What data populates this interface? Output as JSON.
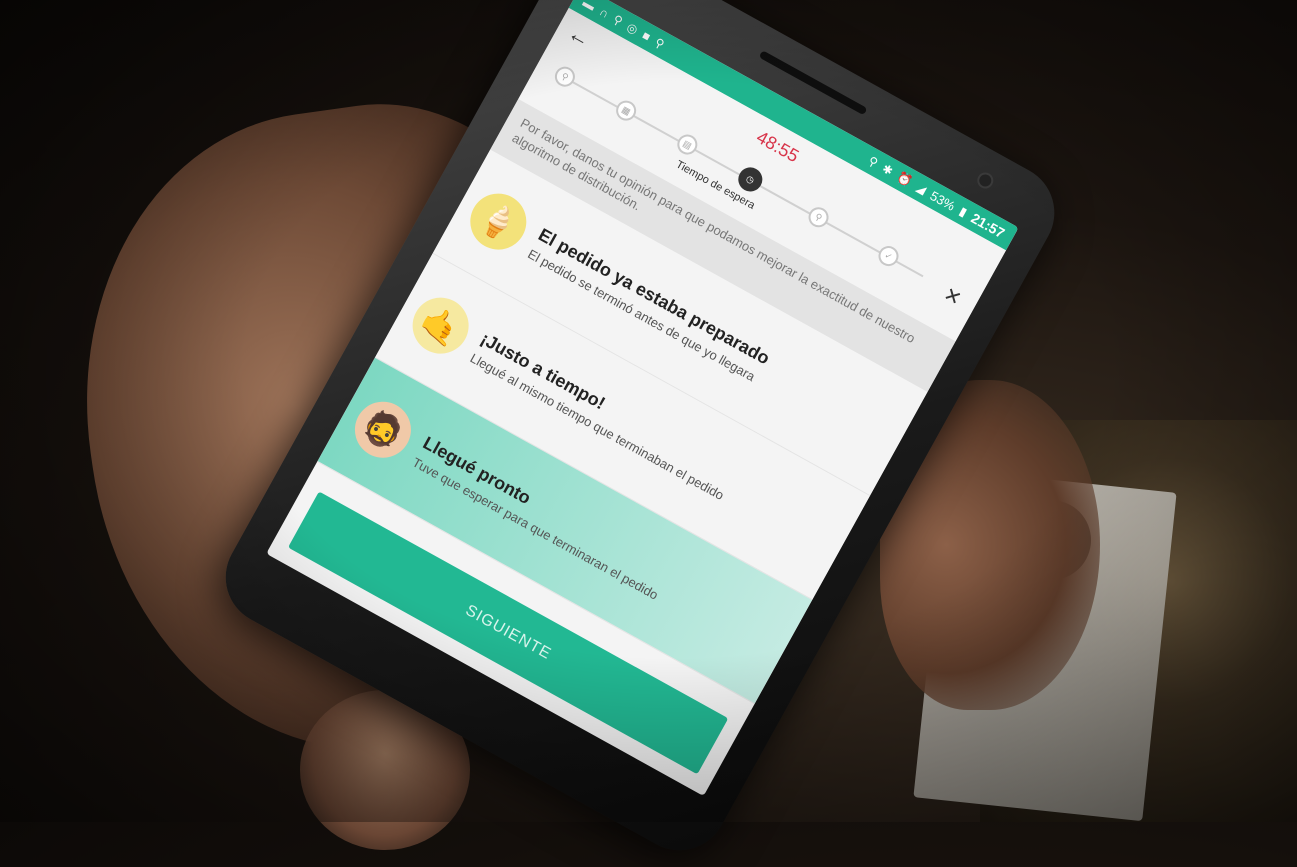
{
  "status_bar": {
    "battery": "53%",
    "time": "21:57"
  },
  "app_bar": {
    "back_icon": "arrow-left-icon",
    "timer": "48:55",
    "close_icon": "close-icon"
  },
  "stepper": {
    "active_label": "Tiempo de espera",
    "active_index": 3,
    "steps_total": 6
  },
  "intro_text": "Por favor, danos tu opinión para que podamos mejorar la exactitud de nuestro algoritmo de distribución.",
  "options": [
    {
      "title": "El pedido ya estaba preparado",
      "desc": "El pedido se terminó antes de que yo llegara",
      "icon": "ice-cream-icon",
      "selected": false
    },
    {
      "title": "¡Justo a tiempo!",
      "desc": "Llegué al mismo tiempo que terminaban el pedido",
      "icon": "hand-gesture-icon",
      "selected": false
    },
    {
      "title": "Llegué pronto",
      "desc": "Tuve que esperar para que terminaran el pedido",
      "icon": "waiting-person-icon",
      "selected": true
    }
  ],
  "button": {
    "label": "SIGUIENTE"
  },
  "colors": {
    "accent": "#1fb48e",
    "timer": "#d8344a",
    "selected_row": "#7dd8c2"
  }
}
